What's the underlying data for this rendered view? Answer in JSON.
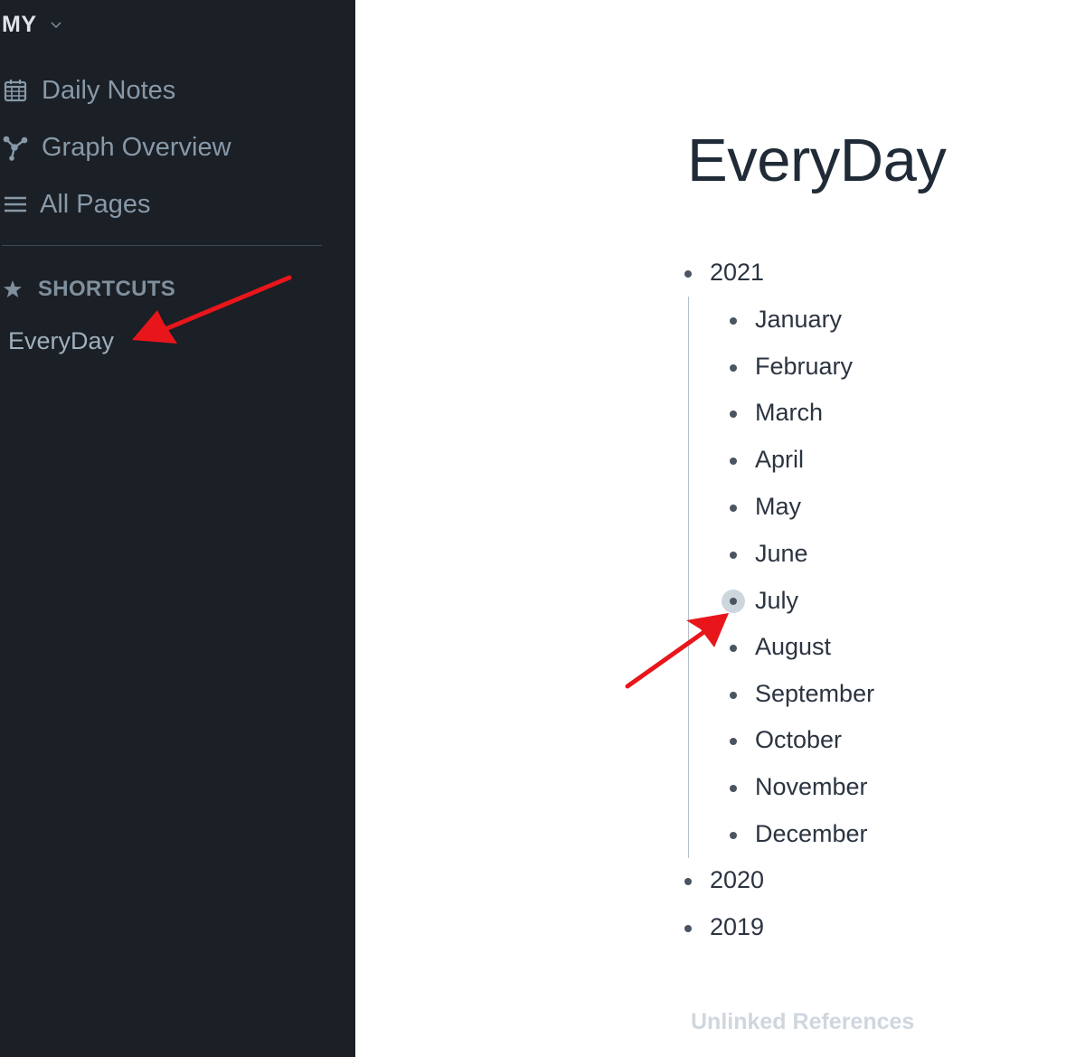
{
  "sidebar": {
    "workspace": {
      "name": "MY",
      "chevron_icon": "chevron-down-icon"
    },
    "nav": [
      {
        "label": "Daily Notes",
        "icon": "calendar-icon"
      },
      {
        "label": "Graph Overview",
        "icon": "graph-icon"
      },
      {
        "label": "All Pages",
        "icon": "list-icon"
      }
    ],
    "shortcuts": {
      "label": "SHORTCUTS",
      "icon": "star-icon",
      "items": [
        {
          "label": "EveryDay"
        }
      ]
    }
  },
  "page": {
    "title": "EveryDay",
    "blocks": [
      {
        "text": "2021",
        "children": [
          {
            "text": "January"
          },
          {
            "text": "February"
          },
          {
            "text": "March"
          },
          {
            "text": "April"
          },
          {
            "text": "May"
          },
          {
            "text": "June"
          },
          {
            "text": "July",
            "collapsed": true
          },
          {
            "text": "August"
          },
          {
            "text": "September"
          },
          {
            "text": "October"
          },
          {
            "text": "November"
          },
          {
            "text": "December"
          }
        ]
      },
      {
        "text": "2020"
      },
      {
        "text": "2019"
      }
    ],
    "unlinked_references": "Unlinked References"
  },
  "colors": {
    "sidebar_bg": "#1b1f26",
    "sidebar_text": "#8799a8",
    "title_text": "#202b37",
    "annotation_arrow": "#e8161b"
  }
}
